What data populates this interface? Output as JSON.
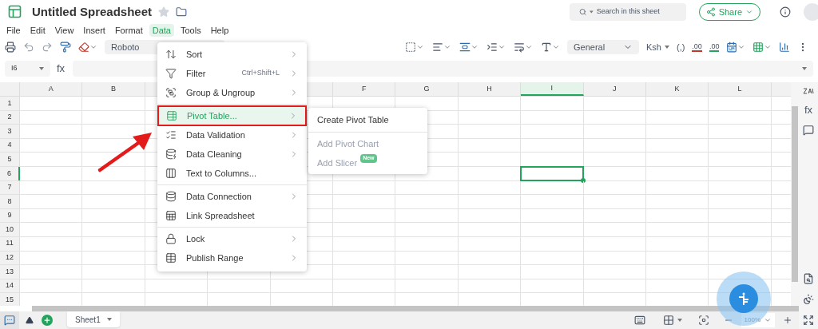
{
  "title": "Untitled Spreadsheet",
  "menu": [
    {
      "label": "File",
      "selected": false
    },
    {
      "label": "Edit",
      "selected": false
    },
    {
      "label": "View",
      "selected": false
    },
    {
      "label": "Insert",
      "selected": false
    },
    {
      "label": "Format",
      "selected": false
    },
    {
      "label": "Data",
      "selected": true
    },
    {
      "label": "Tools",
      "selected": false
    },
    {
      "label": "Help",
      "selected": false
    }
  ],
  "search": {
    "placeholder": "Search in this sheet"
  },
  "share": "Share",
  "toolbar": {
    "font": "Roboto",
    "number_format": "General",
    "currency": "Ksh",
    "thousands": "(,)",
    "decimals": [
      ".00",
      ".00"
    ]
  },
  "name_box": "I6",
  "fx": "fx",
  "columns": [
    {
      "label": "A",
      "selected": false
    },
    {
      "label": "B",
      "selected": false
    },
    {
      "label": "F",
      "selected": false
    },
    {
      "label": "G",
      "selected": false
    },
    {
      "label": "H",
      "selected": false
    },
    {
      "label": "I",
      "selected": true
    },
    {
      "label": "J",
      "selected": false
    },
    {
      "label": "K",
      "selected": false
    },
    {
      "label": "L",
      "selected": false
    }
  ],
  "rows": [
    {
      "label": "1",
      "selected": false
    },
    {
      "label": "2",
      "selected": false
    },
    {
      "label": "3",
      "selected": false
    },
    {
      "label": "4",
      "selected": false
    },
    {
      "label": "5",
      "selected": false
    },
    {
      "label": "6",
      "selected": true
    },
    {
      "label": "7",
      "selected": false
    },
    {
      "label": "8",
      "selected": false
    },
    {
      "label": "9",
      "selected": false
    },
    {
      "label": "10",
      "selected": false
    },
    {
      "label": "11",
      "selected": false
    },
    {
      "label": "12",
      "selected": false
    },
    {
      "label": "13",
      "selected": false
    },
    {
      "label": "14",
      "selected": false
    },
    {
      "label": "15",
      "selected": false
    }
  ],
  "data_menu": [
    [
      {
        "label": "Sort",
        "submenu": true,
        "selected": false
      },
      {
        "label": "Filter",
        "shortcut": "Ctrl+Shift+L",
        "submenu": true,
        "selected": false
      },
      {
        "label": "Group & Ungroup",
        "submenu": true,
        "selected": false
      }
    ],
    [
      {
        "label": "Pivot Table...",
        "submenu": true,
        "selected": true
      },
      {
        "label": "Data Validation",
        "submenu": true,
        "selected": false
      },
      {
        "label": "Data Cleaning",
        "submenu": true,
        "selected": false
      },
      {
        "label": "Text to Columns...",
        "submenu": false,
        "selected": false
      }
    ],
    [
      {
        "label": "Data Connection",
        "submenu": true,
        "selected": false
      },
      {
        "label": "Link Spreadsheet",
        "submenu": false,
        "selected": false
      }
    ],
    [
      {
        "label": "Lock",
        "submenu": true,
        "selected": false
      },
      {
        "label": "Publish Range",
        "submenu": true,
        "selected": false
      }
    ]
  ],
  "submenu": [
    [
      {
        "label": "Create Pivot Table",
        "disabled": false
      }
    ],
    [
      {
        "label": "Add Pivot Chart",
        "disabled": true
      },
      {
        "label": "Add Slicer",
        "disabled": true,
        "badge": "New"
      }
    ]
  ],
  "side_panel_fx": "fx",
  "sheet_tab": "Sheet1",
  "zoom": "100%"
}
